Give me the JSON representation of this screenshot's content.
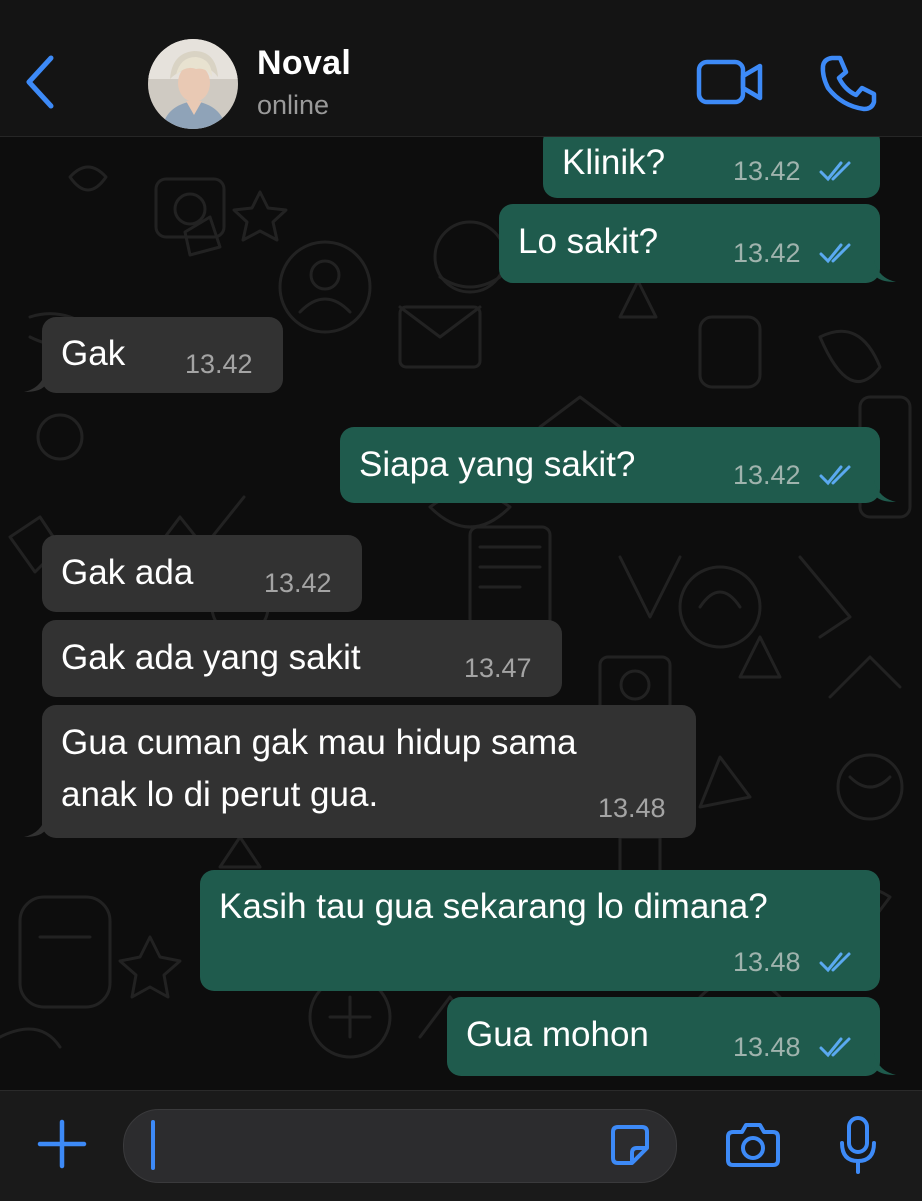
{
  "header": {
    "contact_name": "Noval",
    "status": "online"
  },
  "messages": [
    {
      "direction": "out",
      "text": "Klinik?",
      "time": "13.42",
      "read": true
    },
    {
      "direction": "out",
      "text": "Lo sakit?",
      "time": "13.42",
      "read": true
    },
    {
      "direction": "in",
      "text": "Gak",
      "time": "13.42"
    },
    {
      "direction": "out",
      "text": "Siapa yang sakit?",
      "time": "13.42",
      "read": true
    },
    {
      "direction": "in",
      "text": "Gak ada",
      "time": "13.42"
    },
    {
      "direction": "in",
      "text": "Gak ada yang sakit",
      "time": "13.47"
    },
    {
      "direction": "in",
      "text": "Gua cuman gak mau hidup sama\nanak lo di perut gua.",
      "time": "13.48"
    },
    {
      "direction": "out",
      "text": "Kasih tau gua sekarang lo dimana?",
      "time": "13.48",
      "read": true
    },
    {
      "direction": "out",
      "text": "Gua mohon",
      "time": "13.48",
      "read": true
    }
  ],
  "composer": {
    "value": ""
  },
  "icons": {
    "back": "chevron-left-icon",
    "video": "video-camera-icon",
    "call": "phone-icon",
    "attach": "plus-icon",
    "sticker": "sticker-icon",
    "camera": "camera-icon",
    "mic": "microphone-icon"
  },
  "colors": {
    "accent": "#3d8af7",
    "outgoing_bubble": "#1f5b4d",
    "incoming_bubble": "#323232",
    "read_ticks": "#5aa9f0"
  }
}
